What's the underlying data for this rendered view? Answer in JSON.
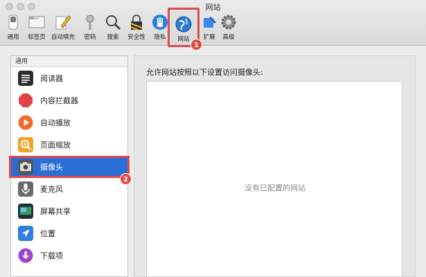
{
  "window": {
    "title": "网站"
  },
  "toolbar": {
    "items": [
      {
        "label": "通用",
        "icon": "switch-icon"
      },
      {
        "label": "标签页",
        "icon": "tabs-icon"
      },
      {
        "label": "自动填充",
        "icon": "pencil-icon"
      },
      {
        "label": "密码",
        "icon": "key-icon"
      },
      {
        "label": "搜索",
        "icon": "magnifier-icon"
      },
      {
        "label": "安全性",
        "icon": "lock-icon"
      },
      {
        "label": "隐私",
        "icon": "hand-icon"
      },
      {
        "label": "网站",
        "icon": "globe-icon"
      },
      {
        "label": "扩展",
        "icon": "puzzle-icon"
      },
      {
        "label": "高级",
        "icon": "gear-icon"
      }
    ]
  },
  "sidebar": {
    "section": "通用",
    "items": [
      {
        "label": "阅读器",
        "icon": "reader-icon",
        "color": "#2d2d2d"
      },
      {
        "label": "内容拦截器",
        "icon": "stop-icon",
        "color": "#e04444"
      },
      {
        "label": "自动播放",
        "icon": "play-icon",
        "color": "#ef6b2b"
      },
      {
        "label": "页面缩放",
        "icon": "zoom-icon",
        "color": "#f0a326"
      },
      {
        "label": "摄像头",
        "icon": "camera-icon",
        "color": "#555555"
      },
      {
        "label": "麦克风",
        "icon": "microphone-icon",
        "color": "#6a6a6a"
      },
      {
        "label": "屏幕共享",
        "icon": "screen-share-icon",
        "color": "#3e9c4a"
      },
      {
        "label": "位置",
        "icon": "location-icon",
        "color": "#2f7ee0"
      },
      {
        "label": "下载项",
        "icon": "download-icon",
        "color": "#a341c8"
      }
    ]
  },
  "main": {
    "label": "允许网站按照以下设置访问摄像头:",
    "empty_text": "没有已配置的网站"
  },
  "annotations": {
    "badge1": "1",
    "badge2": "2"
  },
  "colors": {
    "highlight": "#e04a4a",
    "selection": "#2b6fd6"
  }
}
